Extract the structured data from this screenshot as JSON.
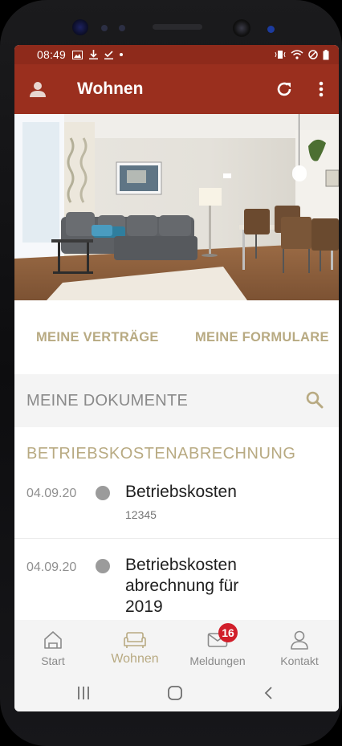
{
  "status_bar": {
    "time": "08:49",
    "left_icons": [
      "image-icon",
      "download-icon",
      "check-download-icon",
      "dot-icon"
    ],
    "right_icons": [
      "vibrate-icon",
      "wifi-icon",
      "block-icon",
      "battery-icon"
    ]
  },
  "app_bar": {
    "title": "Wohnen",
    "color": "#9a2f1e"
  },
  "tabs": [
    {
      "label": "MEINE VERTRÄGE"
    },
    {
      "label": "MEINE FORMULARE"
    }
  ],
  "documents_header": {
    "label": "MEINE DOKUMENTE"
  },
  "section_title": "BETRIEBSKOSTENABRECHNUNG",
  "documents": [
    {
      "date": "04.09.20",
      "title": "Betriebskosten",
      "subtitle": "12345"
    },
    {
      "date": "04.09.20",
      "title_lines": [
        "Betriebskosten",
        "abrechnung für",
        "2019"
      ]
    }
  ],
  "bottom_nav": [
    {
      "label": "Start",
      "icon": "home-icon"
    },
    {
      "label": "Wohnen",
      "icon": "sofa-icon",
      "active": true
    },
    {
      "label": "Meldungen",
      "icon": "mail-icon",
      "badge": "16"
    },
    {
      "label": "Kontakt",
      "icon": "person-icon"
    }
  ],
  "colors": {
    "accent": "#b8aa82",
    "badge": "#d11e2a",
    "appbar": "#9a2f1e",
    "statusbar": "#8e2a1b"
  }
}
